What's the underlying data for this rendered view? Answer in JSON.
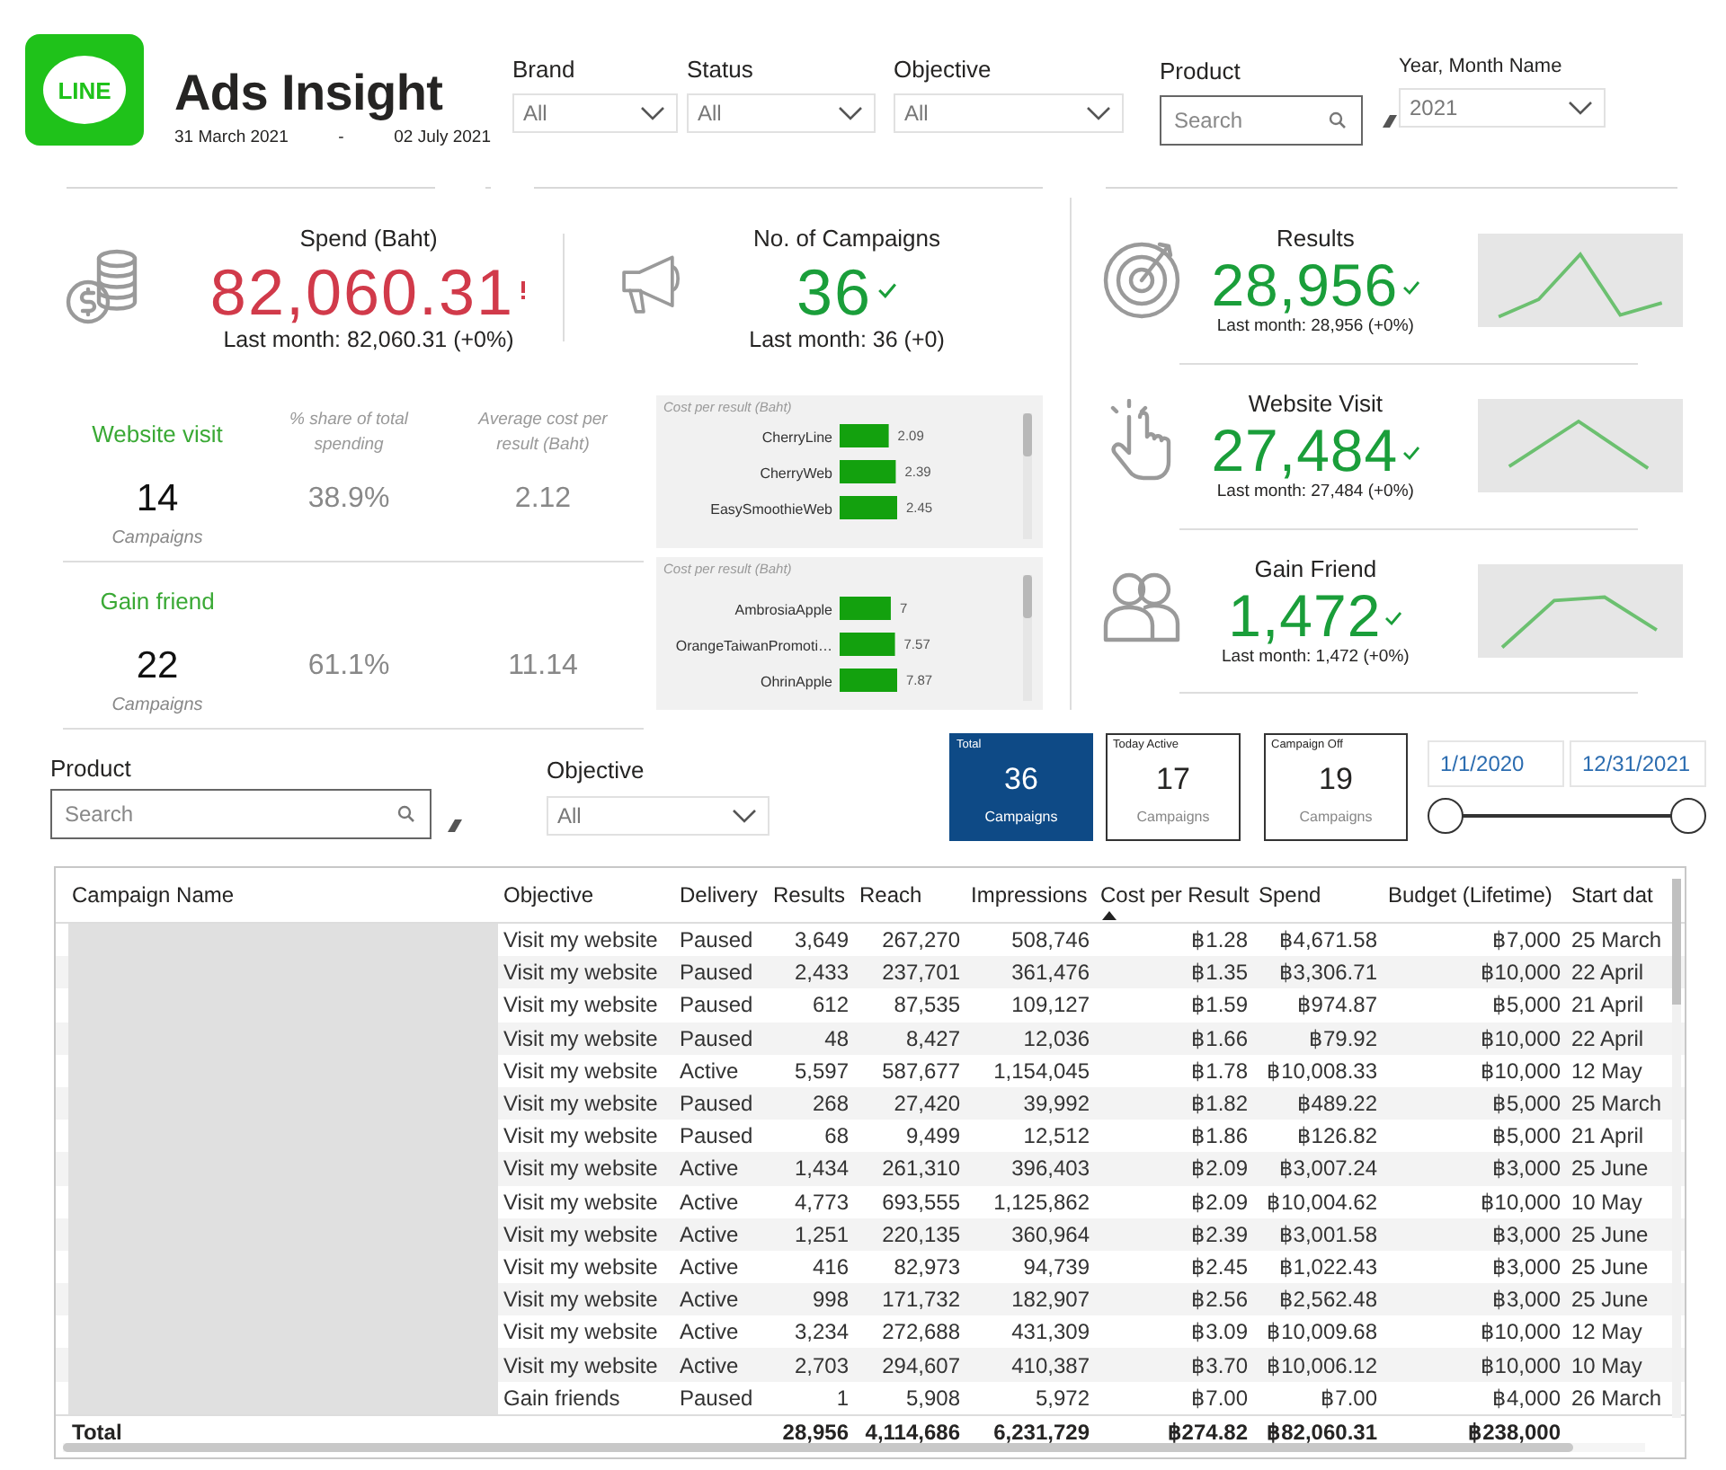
{
  "header": {
    "logo_text": "LINE",
    "title": "Ads Insight",
    "date_from": "31 March 2021",
    "date_separator": "-",
    "date_to": "02 July 2021"
  },
  "filters": [
    {
      "label": "Brand",
      "kind": "dropdown",
      "value": "All"
    },
    {
      "label": "Status",
      "kind": "dropdown",
      "value": "All"
    },
    {
      "label": "Objective",
      "kind": "dropdown",
      "value": "All"
    },
    {
      "label": "Product",
      "kind": "search",
      "placeholder": "Search"
    },
    {
      "label": "Year, Month Name",
      "kind": "dropdown",
      "value": "2021"
    }
  ],
  "kpis": [
    {
      "title": "Spend (Baht)",
      "value": "82,060.31",
      "kind": "warning",
      "compare": "Last month: 82,060.31 (+0%)"
    },
    {
      "title": "No. of Campaigns",
      "value": "36",
      "kind": "good",
      "compare": "Last month: 36 (+0)"
    }
  ],
  "objectives": {
    "share_header": "% share of total spending",
    "avg_cost_header": "Average cost per result (Baht)",
    "rows": [
      {
        "name": "Website visit",
        "count": "14",
        "unit": "Campaigns",
        "share": "38.9%",
        "avg_cost": "2.12"
      },
      {
        "name": "Gain friend",
        "count": "22",
        "unit": "Campaigns",
        "share": "61.1%",
        "avg_cost": "11.14"
      }
    ]
  },
  "cost_charts": [
    {
      "chart_data": {
        "type": "bar",
        "orientation": "horizontal",
        "title": "Cost per result (Baht)",
        "categories": [
          "CherryLine",
          "CherryWeb",
          "EasySmoothieWeb"
        ],
        "series": [
          {
            "color": "#13a10e",
            "values": [
              2.09,
              2.39,
              2.45
            ]
          }
        ],
        "data_labels": true
      }
    },
    {
      "chart_data": {
        "type": "bar",
        "orientation": "horizontal",
        "title": "Cost per result (Baht)",
        "categories": [
          "AmbrosiaApple",
          "OrangeTaiwanPromoti…",
          "OhrinApple"
        ],
        "series": [
          {
            "color": "#13a10e",
            "values": [
              7,
              7.57,
              7.87
            ]
          }
        ],
        "data_labels": true
      }
    }
  ],
  "metrics": [
    {
      "title": "Results",
      "value": "28,956",
      "kind": "good",
      "compare": "Last month: 28,956 (+0%)"
    },
    {
      "title": "Website Visit",
      "value": "27,484",
      "kind": "good",
      "compare": "Last month: 27,484 (+0%)"
    },
    {
      "title": "Gain Friend",
      "value": "1,472",
      "kind": "good",
      "compare": "Last month: 1,472 (+0%)"
    }
  ],
  "table_filters": [
    {
      "label": "Product",
      "kind": "search",
      "placeholder": "Search"
    },
    {
      "label": "Objective",
      "kind": "dropdown",
      "value": "All"
    }
  ],
  "campaign_cards": [
    {
      "title": "Total",
      "value": "36",
      "unit": "Campaigns",
      "selected": true
    },
    {
      "title": "Today Active",
      "value": "17",
      "unit": "Campaigns",
      "selected": false
    },
    {
      "title": "Campaign Off",
      "value": "19",
      "unit": "Campaigns",
      "selected": false
    }
  ],
  "date_range": {
    "from": "1/1/2020",
    "to": "12/31/2021",
    "handles": [
      {
        "level": 0
      },
      {
        "level": 1
      }
    ]
  },
  "table": {
    "columns": [
      {
        "label": "Campaign Name",
        "sorted": false
      },
      {
        "label": "Objective",
        "sorted": false
      },
      {
        "label": "Delivery",
        "sorted": false
      },
      {
        "label": "Results",
        "sorted": false
      },
      {
        "label": "Reach",
        "sorted": false
      },
      {
        "label": "Impressions",
        "sorted": false
      },
      {
        "label": "Cost per Result",
        "sorted": true
      },
      {
        "label": "Spend",
        "sorted": false
      },
      {
        "label": "Budget (Lifetime)",
        "sorted": false
      },
      {
        "label": "Start dat",
        "sorted": false
      }
    ],
    "rows": [
      [
        "",
        "Visit my website",
        "Paused",
        "3,649",
        "267,270",
        "508,746",
        "฿1.28",
        "฿4,671.58",
        "฿7,000",
        "25 March"
      ],
      [
        "",
        "Visit my website",
        "Paused",
        "2,433",
        "237,701",
        "361,476",
        "฿1.35",
        "฿3,306.71",
        "฿10,000",
        "22 April"
      ],
      [
        "",
        "Visit my website",
        "Paused",
        "612",
        "87,535",
        "109,127",
        "฿1.59",
        "฿974.87",
        "฿5,000",
        "21 April"
      ],
      [
        "",
        "Visit my website",
        "Paused",
        "48",
        "8,427",
        "12,036",
        "฿1.66",
        "฿79.92",
        "฿10,000",
        "22 April"
      ],
      [
        "",
        "Visit my website",
        "Active",
        "5,597",
        "587,677",
        "1,154,045",
        "฿1.78",
        "฿10,008.33",
        "฿10,000",
        "12 May"
      ],
      [
        "",
        "Visit my website",
        "Paused",
        "268",
        "27,420",
        "39,992",
        "฿1.82",
        "฿489.22",
        "฿5,000",
        "25 March"
      ],
      [
        "",
        "Visit my website",
        "Paused",
        "68",
        "9,499",
        "12,512",
        "฿1.86",
        "฿126.82",
        "฿5,000",
        "21 April"
      ],
      [
        "",
        "Visit my website",
        "Active",
        "1,434",
        "261,310",
        "396,403",
        "฿2.09",
        "฿3,007.24",
        "฿3,000",
        "25 June"
      ],
      [
        "",
        "Visit my website",
        "Active",
        "4,773",
        "693,555",
        "1,125,862",
        "฿2.09",
        "฿10,004.62",
        "฿10,000",
        "10 May"
      ],
      [
        "",
        "Visit my website",
        "Active",
        "1,251",
        "220,135",
        "360,964",
        "฿2.39",
        "฿3,001.58",
        "฿3,000",
        "25 June"
      ],
      [
        "",
        "Visit my website",
        "Active",
        "416",
        "82,973",
        "94,739",
        "฿2.45",
        "฿1,022.43",
        "฿3,000",
        "25 June"
      ],
      [
        "",
        "Visit my website",
        "Active",
        "998",
        "171,732",
        "182,907",
        "฿2.56",
        "฿2,562.48",
        "฿3,000",
        "25 June"
      ],
      [
        "",
        "Visit my website",
        "Active",
        "3,234",
        "272,688",
        "431,309",
        "฿3.09",
        "฿10,009.68",
        "฿10,000",
        "12 May"
      ],
      [
        "",
        "Visit my website",
        "Active",
        "2,703",
        "294,607",
        "410,387",
        "฿3.70",
        "฿10,006.12",
        "฿10,000",
        "10 May"
      ],
      [
        "",
        "Gain friends",
        "Paused",
        "1",
        "5,908",
        "5,972",
        "฿7.00",
        "฿7.00",
        "฿4,000",
        "26 March"
      ]
    ],
    "total": {
      "label": "Total",
      "results": "28,956",
      "reach": "4,114,686",
      "impressions": "6,231,729",
      "cost_per_result": "฿274.82",
      "spend": "฿82,060.31",
      "budget": "฿238,000"
    }
  }
}
